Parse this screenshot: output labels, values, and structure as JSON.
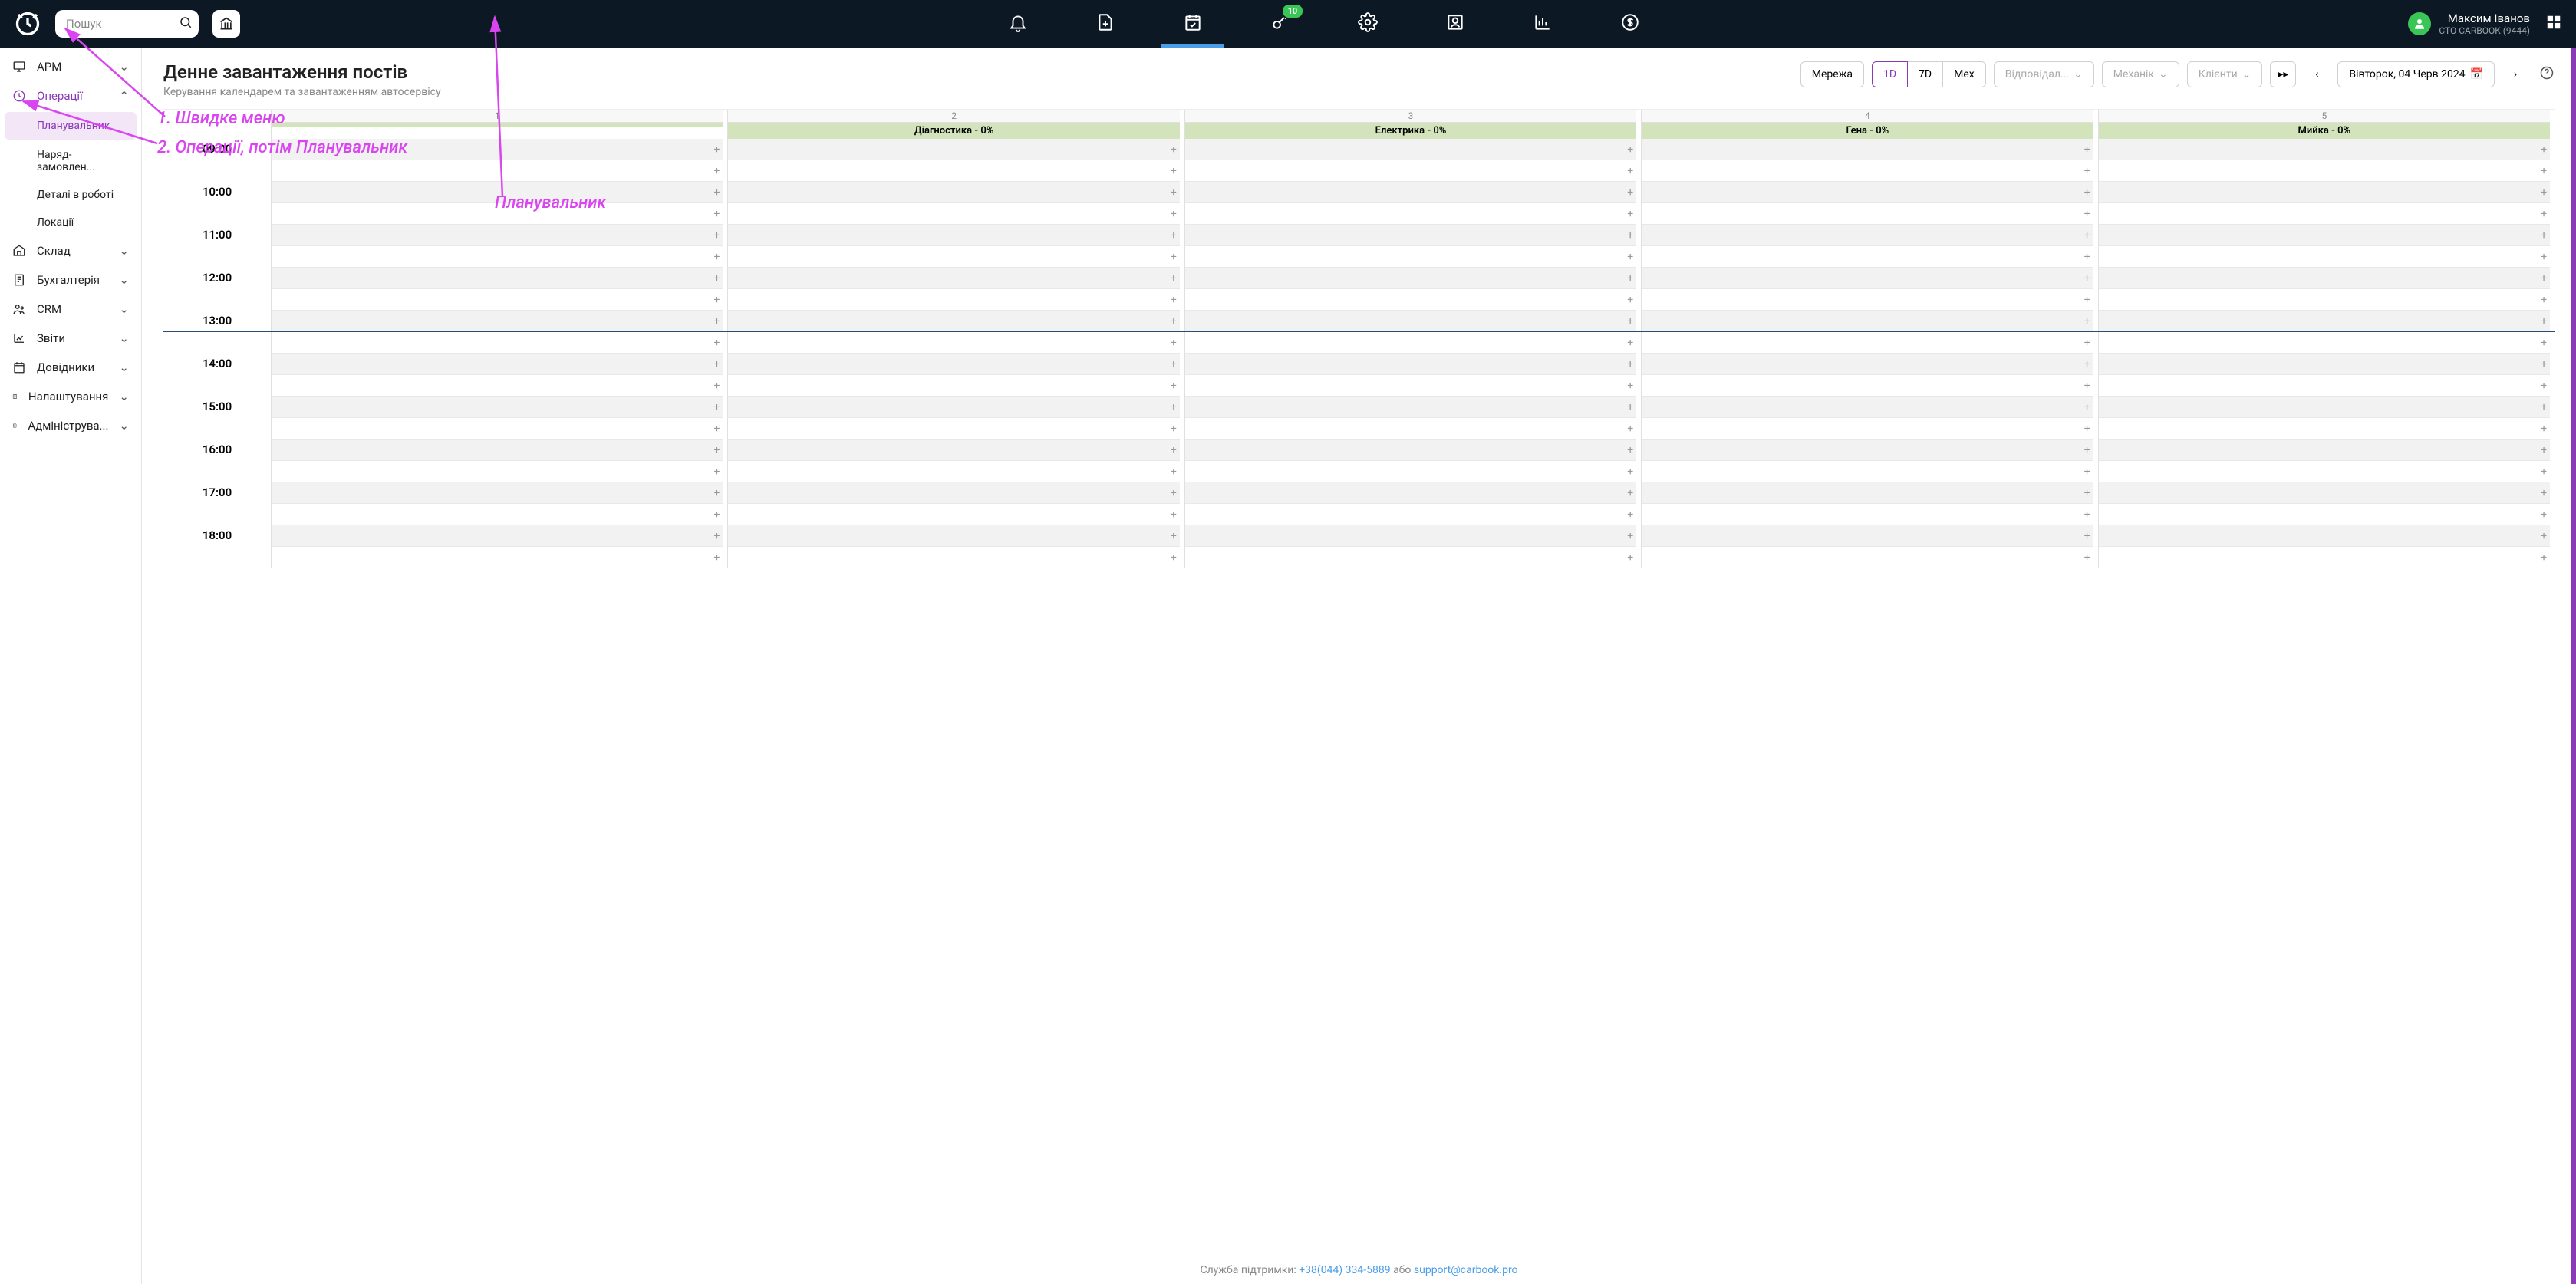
{
  "search": {
    "placeholder": "Пошук"
  },
  "topIcons": {
    "keyBadge": "10"
  },
  "user": {
    "name": "Максим Іванов",
    "sub": "СТО CARBOOK (9444)"
  },
  "sidebar": {
    "items": [
      {
        "label": "АРМ"
      },
      {
        "label": "Операції"
      },
      {
        "label": "Склад"
      },
      {
        "label": "Бухгалтерія"
      },
      {
        "label": "CRM"
      },
      {
        "label": "Звіти"
      },
      {
        "label": "Довідники"
      },
      {
        "label": "Налаштування"
      },
      {
        "label": "Адмініструва..."
      }
    ],
    "subs": [
      {
        "label": "Планувальник"
      },
      {
        "label": "Наряд-замовлен..."
      },
      {
        "label": "Деталі в роботі"
      },
      {
        "label": "Локації"
      }
    ]
  },
  "page": {
    "title": "Денне завантаження постів",
    "subtitle": "Керування календарем та завантаженням автосервісу"
  },
  "toolbar": {
    "network": "Мережа",
    "view1d": "1D",
    "view7d": "7D",
    "viewMex": "Мех",
    "responsible": "Відповідал...",
    "mechanic": "Механік",
    "clients": "Клієнти",
    "date": "Вівторок, 04 Черв 2024"
  },
  "columns": [
    {
      "num": "1",
      "label": ""
    },
    {
      "num": "2",
      "label": "Діагностика - 0%"
    },
    {
      "num": "3",
      "label": "Електрика - 0%"
    },
    {
      "num": "4",
      "label": "Гена - 0%"
    },
    {
      "num": "5",
      "label": "Мийка - 0%"
    }
  ],
  "hours": [
    "09:00",
    "10:00",
    "11:00",
    "12:00",
    "13:00",
    "14:00",
    "15:00",
    "16:00",
    "17:00",
    "18:00"
  ],
  "annotations": {
    "line1": "1. Швидке меню",
    "line2": "2. Операції, потім Планувальник",
    "line3": "Планувальник"
  },
  "footer": {
    "prefix": "Служба підтримки: ",
    "phone": "+38(044) 334-5889",
    "mid": " або ",
    "email": "support@carbook.pro"
  }
}
